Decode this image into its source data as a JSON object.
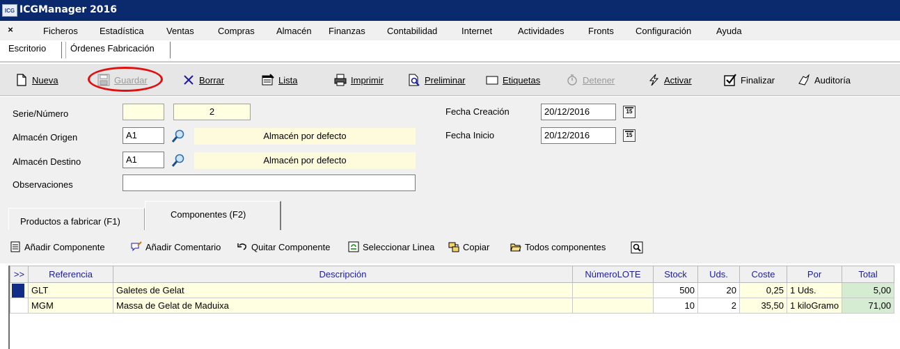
{
  "window": {
    "app_icon_text": "ICG",
    "title": "ICGManager 2016"
  },
  "menu": {
    "close_glyph": "×",
    "items": [
      "Ficheros",
      "Estadística",
      "Ventas",
      "Compras",
      "Almacén",
      "Finanzas",
      "Contabilidad",
      "Internet",
      "Actividades",
      "Fronts",
      "Configuración",
      "Ayuda"
    ]
  },
  "tabs": [
    "Escritorio",
    "Órdenes Fabricación"
  ],
  "toolbar": {
    "nueva": "Nueva",
    "guardar": "Guardar",
    "borrar": "Borrar",
    "lista": "Lista",
    "imprimir": "Imprimir",
    "preliminar": "Preliminar",
    "etiquetas": "Etiquetas",
    "detener": "Detener",
    "activar": "Activar",
    "finalizar": "Finalizar",
    "auditoria": "Auditoría",
    "highlight_color": "#e01010"
  },
  "form": {
    "serie_label": "Serie/Número",
    "serie_value": "",
    "numero_value": "2",
    "almacen_origen_label": "Almacén Origen",
    "almacen_origen_code": "A1",
    "almacen_origen_desc": "Almacén por defecto",
    "almacen_destino_label": "Almacén Destino",
    "almacen_destino_code": "A1",
    "almacen_destino_desc": "Almacén por defecto",
    "observaciones_label": "Observaciones",
    "observaciones_value": "",
    "fecha_creacion_label": "Fecha Creación",
    "fecha_creacion_value": "20/12/2016",
    "fecha_inicio_label": "Fecha Inicio",
    "fecha_inicio_value": "20/12/2016",
    "calendar_glyph": "15"
  },
  "subtabs": {
    "productos": "Productos a fabricar (F1)",
    "componentes": "Componentes (F2)"
  },
  "comp_toolbar": {
    "anadir_componente": "Añadir Componente",
    "anadir_comentario": "Añadir Comentario",
    "quitar_componente": "Quitar Componente",
    "seleccionar_linea": "Seleccionar Linea",
    "copiar": "Copiar",
    "todos_componentes": "Todos componentes"
  },
  "grid": {
    "columns": [
      ">>",
      "Referencia",
      "Descripción",
      "NúmeroLOTE",
      "Stock",
      "Uds.",
      "Coste",
      "Por",
      "Total"
    ],
    "rows": [
      {
        "ref": "GLT",
        "desc": "Galetes de Gelat",
        "lote": "",
        "stock": "500",
        "uds": "20",
        "coste": "0,25",
        "por": "1 Uds.",
        "total": "5,00"
      },
      {
        "ref": "MGM",
        "desc": "Massa de Gelat de Maduixa",
        "lote": "",
        "stock": "10",
        "uds": "2",
        "coste": "35,50",
        "por": "1 kiloGramo",
        "total": "71,00"
      }
    ]
  }
}
